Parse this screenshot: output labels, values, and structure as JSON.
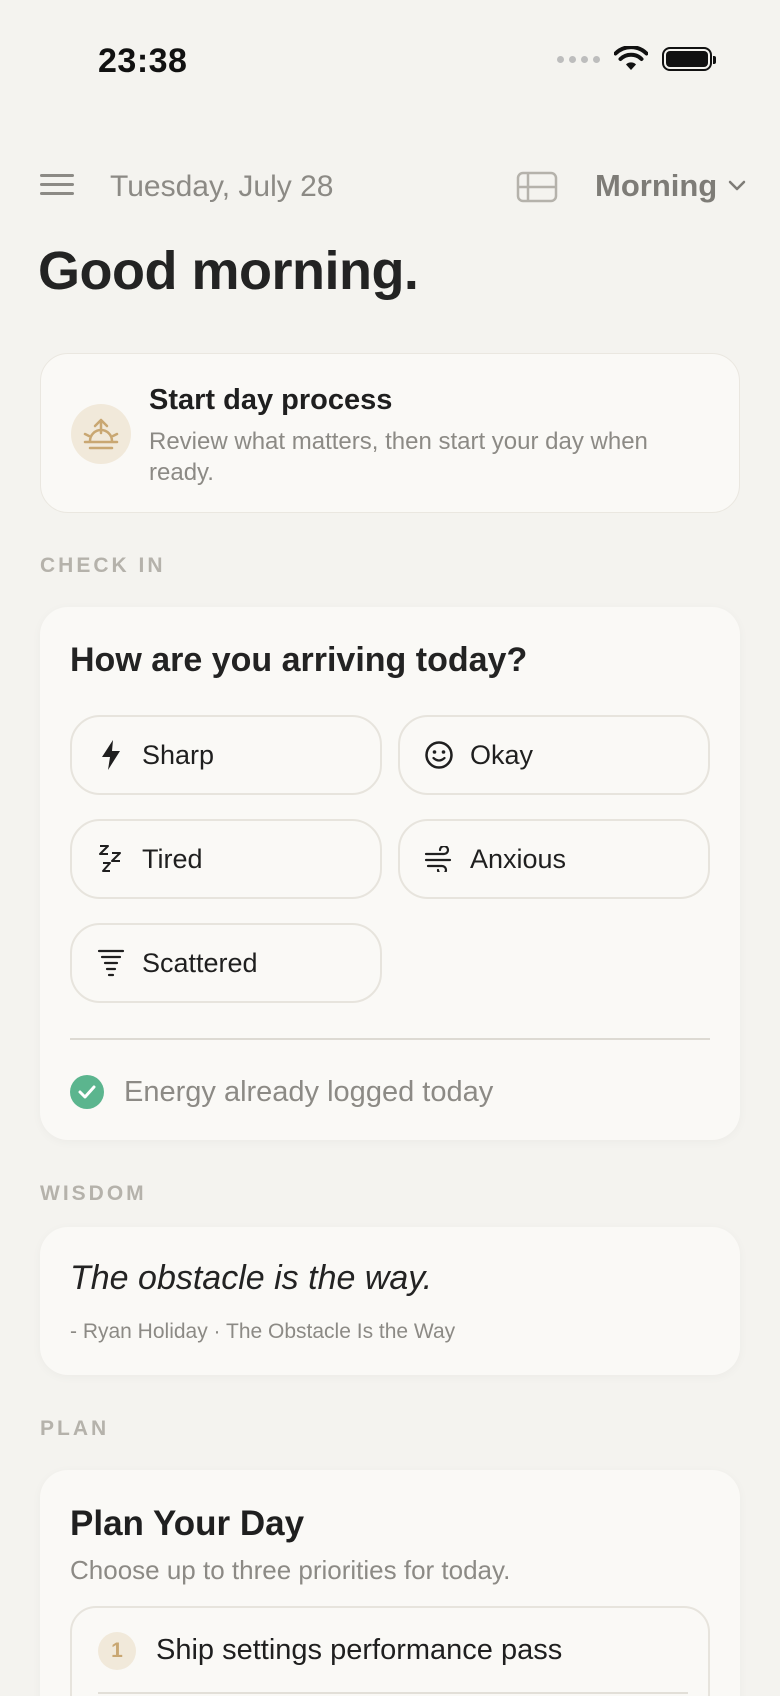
{
  "status_bar": {
    "time": "23:38"
  },
  "header": {
    "date": "Tuesday, July 28",
    "period": "Morning"
  },
  "greeting": "Good morning.",
  "start_day": {
    "title": "Start day process",
    "subtitle": "Review what matters, then start your day when ready."
  },
  "checkin": {
    "section_label": "CHECK IN",
    "question": "How are you arriving today?",
    "moods": [
      {
        "label": "Sharp",
        "icon": "lightning-icon"
      },
      {
        "label": "Okay",
        "icon": "smile-icon"
      },
      {
        "label": "Tired",
        "icon": "sleep-zzz-icon"
      },
      {
        "label": "Anxious",
        "icon": "wind-icon"
      },
      {
        "label": "Scattered",
        "icon": "tornado-icon"
      }
    ],
    "energy_status": "Energy already logged today"
  },
  "wisdom": {
    "section_label": "WISDOM",
    "quote": "The obstacle is the way.",
    "source": "- Ryan Holiday · The Obstacle Is the Way"
  },
  "plan": {
    "section_label": "PLAN",
    "title": "Plan Your Day",
    "subtitle": "Choose up to three priorities for today.",
    "priorities": [
      {
        "number": "1",
        "text": "Ship settings performance pass"
      }
    ]
  },
  "colors": {
    "background": "#F4F3EF",
    "card": "#FAF9F6",
    "success": "#5BB58E",
    "accent_warm": "#C9A772"
  }
}
